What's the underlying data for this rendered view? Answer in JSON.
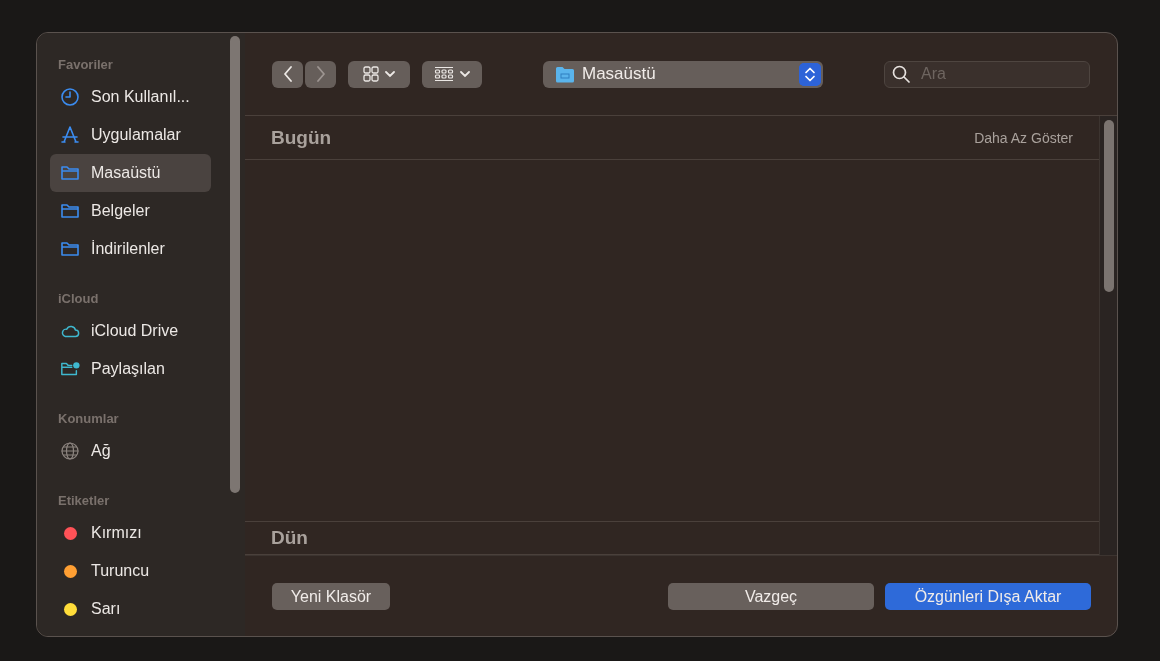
{
  "sidebar": {
    "sections": [
      {
        "heading": "Favoriler",
        "items": [
          {
            "label": "Son Kullanıl...",
            "kind": "clock",
            "selected": false
          },
          {
            "label": "Uygulamalar",
            "kind": "apps",
            "selected": false
          },
          {
            "label": "Masaüstü",
            "kind": "folder",
            "selected": true
          },
          {
            "label": "Belgeler",
            "kind": "folder",
            "selected": false
          },
          {
            "label": "İndirilenler",
            "kind": "folder",
            "selected": false
          }
        ]
      },
      {
        "heading": "iCloud",
        "items": [
          {
            "label": "iCloud Drive",
            "kind": "cloud",
            "selected": false
          },
          {
            "label": "Paylaşılan",
            "kind": "shared",
            "selected": false
          }
        ]
      },
      {
        "heading": "Konumlar",
        "items": [
          {
            "label": "Ağ",
            "kind": "globe",
            "selected": false
          }
        ]
      },
      {
        "heading": "Etiketler",
        "items": [
          {
            "label": "Kırmızı",
            "kind": "tag",
            "color": "#ff5257",
            "selected": false
          },
          {
            "label": "Turuncu",
            "kind": "tag",
            "color": "#ff9f33",
            "selected": false
          },
          {
            "label": "Sarı",
            "kind": "tag",
            "color": "#ffdd3a",
            "selected": false
          }
        ]
      }
    ]
  },
  "toolbar": {
    "back": {
      "disabled": false
    },
    "forward": {
      "disabled": true
    },
    "location": "Masaüstü",
    "search": {
      "placeholder": "Ara"
    }
  },
  "groups": [
    {
      "title": "Bugün",
      "action": "Daha Az Göster",
      "expanded": true
    },
    {
      "title": "Dün",
      "expanded": false
    }
  ],
  "buttons": [
    {
      "label": "Yeni Klasör",
      "kind": "secondary"
    },
    {
      "label": "Vazgeç",
      "kind": "cancel"
    },
    {
      "label": "Özgünleri Dışa Aktar",
      "kind": "primary"
    }
  ]
}
